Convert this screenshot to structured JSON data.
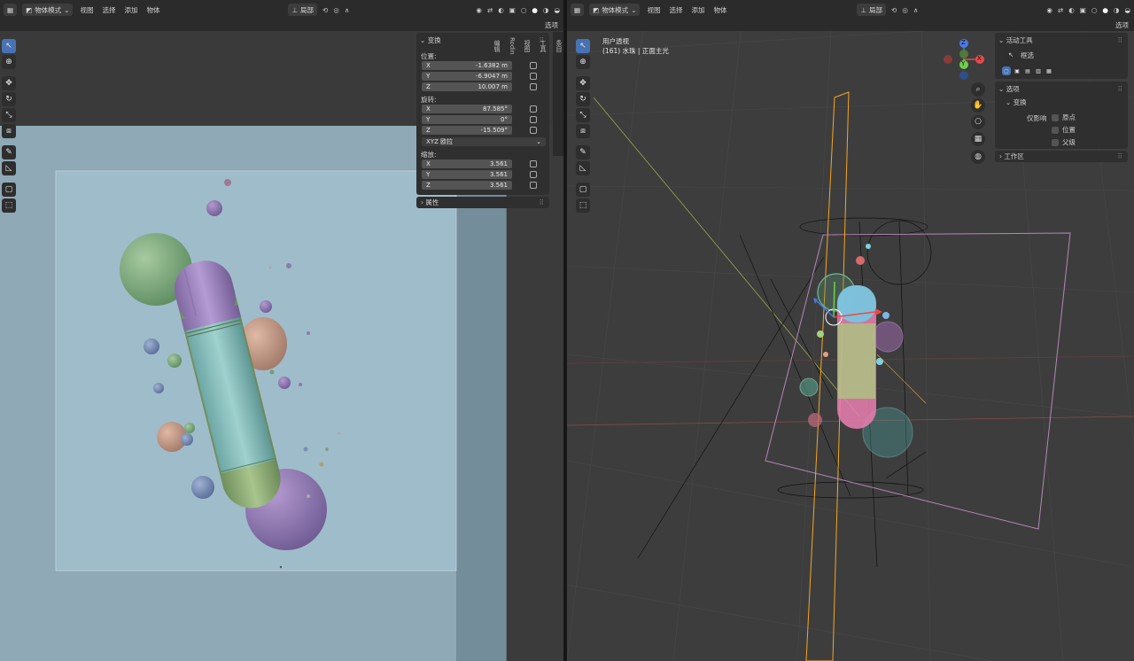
{
  "left_viewport": {
    "header": {
      "mode": "物体模式",
      "menus": [
        "视图",
        "选择",
        "添加",
        "物体"
      ],
      "pivot": "局部",
      "options": "选项"
    },
    "npanel": {
      "transform_title": "变换",
      "location_label": "位置:",
      "location": [
        {
          "axis": "X",
          "value": "-1.6382 m"
        },
        {
          "axis": "Y",
          "value": "-6.9047 m"
        },
        {
          "axis": "Z",
          "value": "10.007 m"
        }
      ],
      "rotation_label": "旋转:",
      "rotation": [
        {
          "axis": "X",
          "value": "87.585°"
        },
        {
          "axis": "Y",
          "value": "0°"
        },
        {
          "axis": "Z",
          "value": "-15.509°"
        }
      ],
      "rotation_mode": "XYZ 欧拉",
      "scale_label": "缩放:",
      "scale": [
        {
          "axis": "X",
          "value": "3.561"
        },
        {
          "axis": "Y",
          "value": "3.561"
        },
        {
          "axis": "Z",
          "value": "3.561"
        }
      ],
      "properties_title": "属性"
    },
    "side_tabs": [
      "条目",
      "工具",
      "视图",
      "Rodin",
      "编辑"
    ]
  },
  "right_viewport": {
    "header": {
      "mode": "物体模式",
      "menus": [
        "视图",
        "选择",
        "添加",
        "物体"
      ],
      "pivot": "局部",
      "options": "选项"
    },
    "overlay": {
      "view_name": "用户透视",
      "object_info": "(161) 水珠 | 正面主光"
    },
    "gizmo": {
      "z": "Z",
      "y": "Y",
      "x": "X"
    },
    "active_tool_panel": {
      "title": "活动工具",
      "tool_name": "框选",
      "options_title": "选项",
      "transform_title": "变换",
      "affect_only_label": "仅影响",
      "checks": [
        "原点",
        "位置",
        "父级"
      ],
      "workspace_title": "工作区"
    }
  },
  "colors": {
    "header_bg": "#2b2b2b",
    "panel_bg": "#2f2f2f",
    "field_bg": "#545454",
    "active_blue": "#4772b3",
    "render_bg": "#9fbccb",
    "bottle_purple": "#9b82b8",
    "bottle_teal": "#7fb6b3",
    "bottle_green": "#93b07a",
    "sphere_green": "#7ea67e",
    "sphere_peach": "#c59c8a",
    "selection_orange": "#f5a623"
  }
}
